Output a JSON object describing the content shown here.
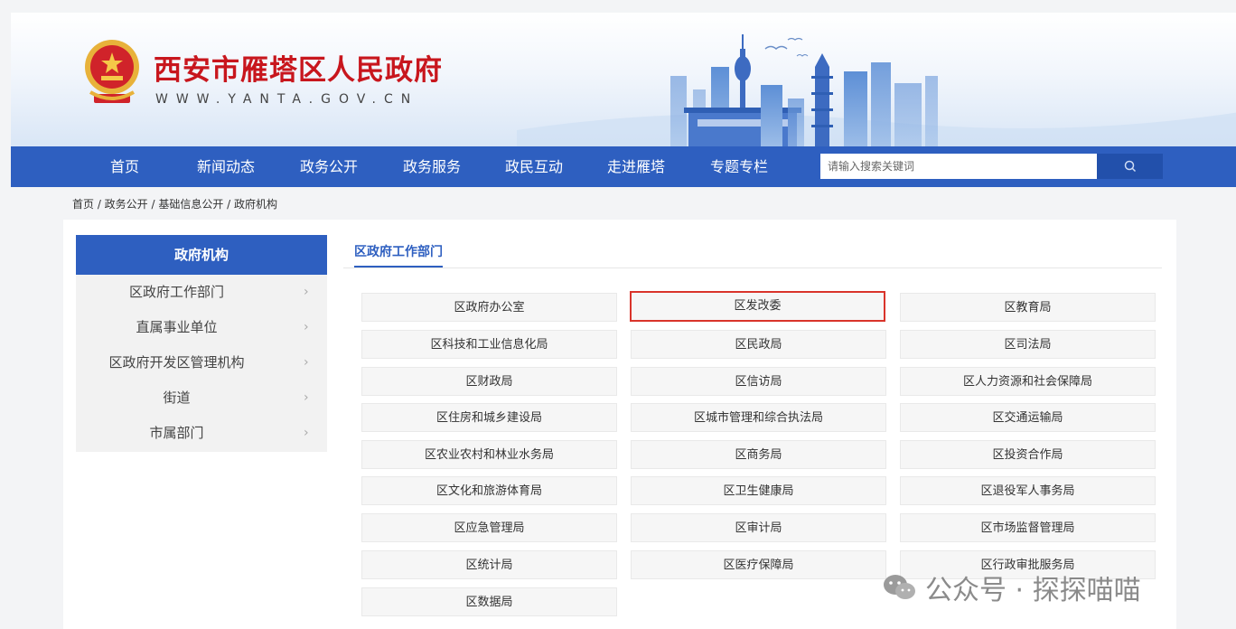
{
  "header": {
    "title": "西安市雁塔区人民政府",
    "url": "WWW.YANTA.GOV.CN"
  },
  "nav": {
    "items": [
      "首页",
      "新闻动态",
      "政务公开",
      "政务服务",
      "政民互动",
      "走进雁塔",
      "专题专栏"
    ],
    "search_placeholder": "请输入搜索关键词"
  },
  "breadcrumb": "首页 / 政务公开 / 基础信息公开 / 政府机构",
  "sidebar": {
    "title": "政府机构",
    "items": [
      "区政府工作部门",
      "直属事业单位",
      "区政府开发区管理机构",
      "街道",
      "市属部门"
    ]
  },
  "main": {
    "section_title": "区政府工作部门",
    "departments": [
      "区政府办公室",
      "区发改委",
      "区教育局",
      "区科技和工业信息化局",
      "区民政局",
      "区司法局",
      "区财政局",
      "区信访局",
      "区人力资源和社会保障局",
      "区住房和城乡建设局",
      "区城市管理和综合执法局",
      "区交通运输局",
      "区农业农村和林业水务局",
      "区商务局",
      "区投资合作局",
      "区文化和旅游体育局",
      "区卫生健康局",
      "区退役军人事务局",
      "区应急管理局",
      "区审计局",
      "区市场监督管理局",
      "区统计局",
      "区医疗保障局",
      "区行政审批服务局",
      "区数据局"
    ],
    "highlighted": "区发改委"
  },
  "watermark": "公众号 · 探探喵喵",
  "colors": {
    "nav_blue": "#2e5fc0",
    "title_red": "#c8161d",
    "highlight_red": "#d9342b"
  }
}
